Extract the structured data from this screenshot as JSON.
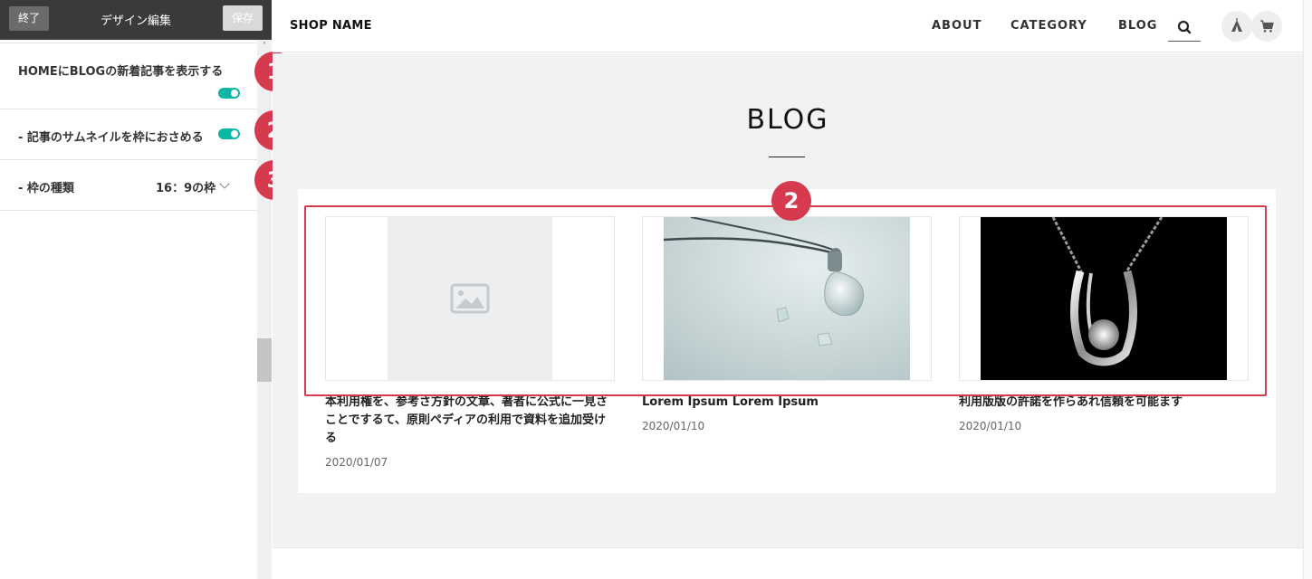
{
  "editor": {
    "end_label": "終了",
    "title": "デザイン編集",
    "save_label": "保存",
    "settings": [
      {
        "label": "HOMEにBLOGの新着記事を表示する",
        "toggle_on": true
      },
      {
        "label": "- 記事のサムネイルを枠におさめる",
        "toggle_on": true
      },
      {
        "label": "- 枠の種類",
        "value": "16：9の枠"
      }
    ],
    "badges": [
      "1",
      "2",
      "3",
      "2"
    ]
  },
  "shop": {
    "name": "SHOP NAME",
    "nav": [
      "ABOUT",
      "CATEGORY",
      "BLOG"
    ],
    "icons": [
      "search-icon",
      "tent-icon",
      "cart-icon"
    ]
  },
  "blog": {
    "heading": "BLOG",
    "posts": [
      {
        "title": "本利用権を、参考さ方針の文章、著者に公式に一見さことでするて、原則ペディアの利用で資料を追加受ける",
        "date": "2020/01/07",
        "image": "placeholder-image-icon"
      },
      {
        "title": "Lorem Ipsum Lorem Ipsum",
        "date": "2020/01/10",
        "image": "crystal-pendant-photo"
      },
      {
        "title": "利用版版の許諾を作らあれ信頼を可能ます",
        "date": "2020/01/10",
        "image": "diamond-necklace-photo"
      }
    ]
  },
  "colors": {
    "accent_red": "#d63a4f",
    "toggle_teal": "#0bb7a5",
    "header_dark": "#3a3a3a"
  }
}
